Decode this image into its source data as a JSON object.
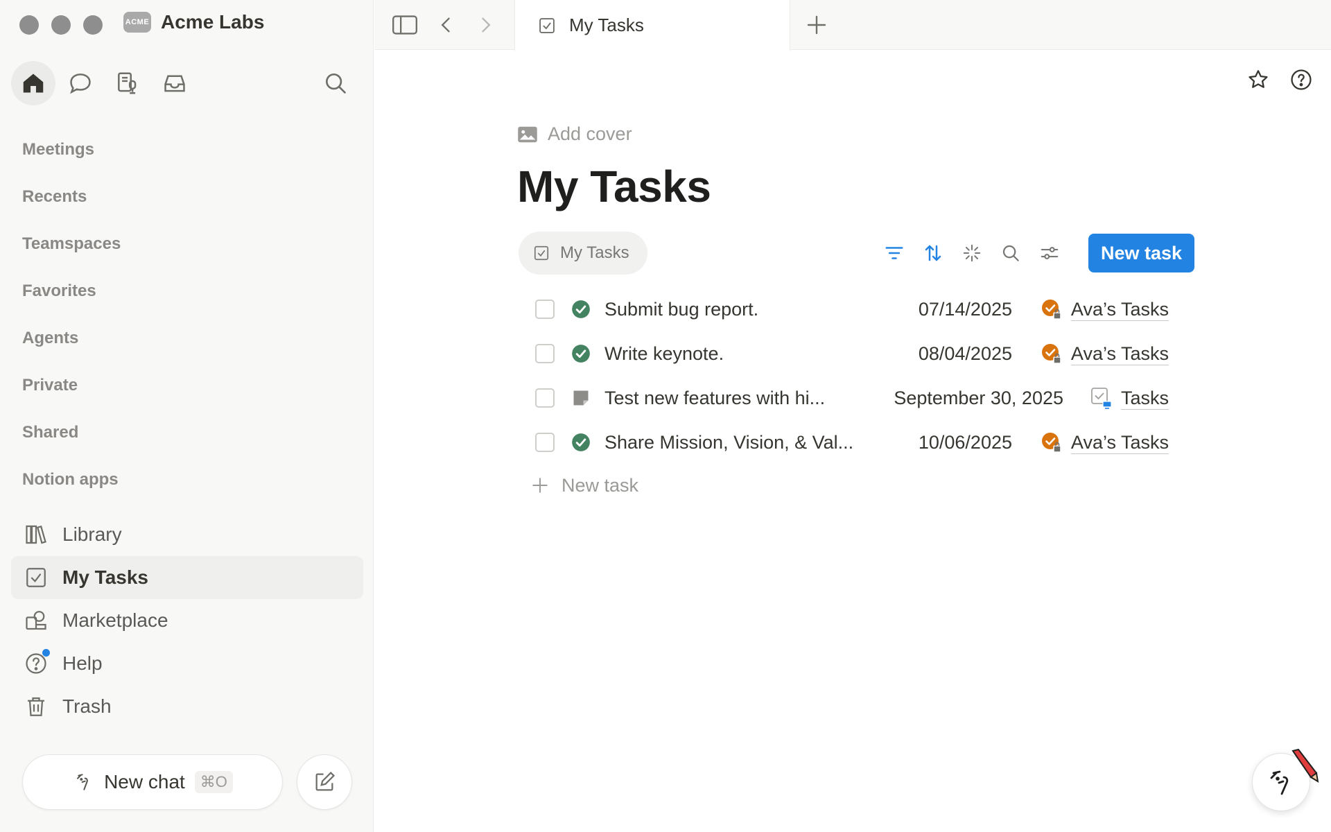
{
  "workspace": {
    "logo_text": "ACME",
    "name": "Acme Labs"
  },
  "sidebar": {
    "nav_items": [
      "Meetings",
      "Recents",
      "Teamspaces",
      "Favorites",
      "Agents",
      "Private",
      "Shared",
      "Notion apps"
    ],
    "lower_items": [
      {
        "label": "Library",
        "icon": "library-icon"
      },
      {
        "label": "My Tasks",
        "icon": "checkbox-icon"
      },
      {
        "label": "Marketplace",
        "icon": "marketplace-icon"
      },
      {
        "label": "Help",
        "icon": "help-icon"
      },
      {
        "label": "Trash",
        "icon": "trash-icon"
      }
    ],
    "new_chat": {
      "label": "New chat",
      "shortcut": "⌘O"
    }
  },
  "tabbar": {
    "active_tab": "My Tasks"
  },
  "page": {
    "add_cover": "Add cover",
    "title": "My Tasks",
    "view_tab": "My Tasks",
    "new_task_button": "New task",
    "add_task_label": "New task",
    "tasks": [
      {
        "title": "Submit bug report.",
        "date": "07/14/2025",
        "list": "Ava’s Tasks",
        "status": "done"
      },
      {
        "title": "Write keynote.",
        "date": "08/04/2025",
        "list": "Ava’s Tasks",
        "status": "done"
      },
      {
        "title": "Test new features with hi...",
        "date": "September 30, 2025",
        "list": "Tasks",
        "status": "note"
      },
      {
        "title": "Share Mission, Vision, & Val...",
        "date": "10/06/2025",
        "list": "Ava’s Tasks",
        "status": "done"
      }
    ]
  },
  "colors": {
    "accent": "#2383e2",
    "done": "#448361",
    "badge": "#d9730d",
    "sidebar_bg": "#f8f8f7"
  }
}
